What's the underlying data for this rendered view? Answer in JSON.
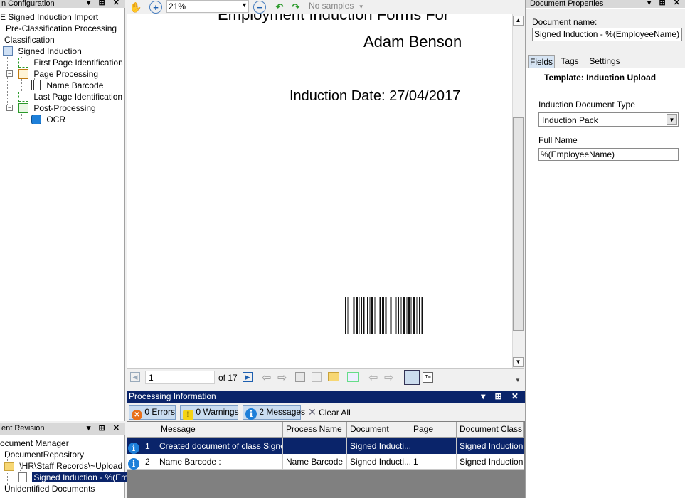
{
  "left_top_panel": {
    "title": "n Configuration",
    "controls": "▾ ⊞ ✕",
    "tree": [
      {
        "label": "E Signed Induction Import"
      },
      {
        "label": "Pre-Classification Processing"
      },
      {
        "label": "Classification"
      },
      {
        "label": "Signed Induction"
      },
      {
        "label": "First Page Identification"
      },
      {
        "label": "Page Processing"
      },
      {
        "label": "Name Barcode"
      },
      {
        "label": "Last Page Identification"
      },
      {
        "label": "Post-Processing"
      },
      {
        "label": "OCR"
      }
    ]
  },
  "left_bottom_panel": {
    "title": "ent Revision",
    "controls": "▾ ⊞ ✕",
    "tree": [
      {
        "label": "ocument Manager"
      },
      {
        "label": "DocumentRepository"
      },
      {
        "label": "\\HR\\Staff Records\\~Upload"
      },
      {
        "label": "Signed Induction - %(Emplo"
      },
      {
        "label": "Unidentified Documents"
      }
    ]
  },
  "viewer": {
    "zoom": "21%",
    "samples_placeholder": "No samples",
    "page_heading_partial": "Employment Induction Forms For",
    "employee_name": "Adam Benson",
    "induction_date_line": "Induction Date: 27/04/2017",
    "page_number": "1",
    "page_total_label": "of 17"
  },
  "processing": {
    "title": "Processing Information",
    "errors_label": "0 Errors",
    "warnings_label": "0 Warnings",
    "messages_label": "2 Messages",
    "clear_label": "Clear All",
    "columns": [
      "Message",
      "Process Name",
      "Document",
      "Page",
      "Document Class"
    ],
    "rows": [
      {
        "index": "1",
        "message": "Created document of class Signe...",
        "process": "",
        "document": "Signed Inducti...",
        "page": "",
        "doc_class": "Signed Induction",
        "selected": true
      },
      {
        "index": "2",
        "message": "Name Barcode :",
        "process": "Name Barcode",
        "document": "Signed Inducti...",
        "page": "1",
        "doc_class": "Signed Induction",
        "selected": false
      }
    ]
  },
  "properties": {
    "title": "Document Properties",
    "doc_name_label": "Document name:",
    "doc_name_value": "Signed Induction - %(EmployeeName)",
    "tabs": [
      "Fields",
      "Tags",
      "Settings"
    ],
    "template_label": "Template: Induction Upload",
    "field1_label": "Induction Document Type",
    "field1_value": "Induction Pack",
    "field2_label": "Full Name",
    "field2_value": "%(EmployeeName)"
  },
  "colors": {
    "selection": "#0a246a",
    "panel_header_active": "#0a246a",
    "info_blue": "#1d7fd9",
    "error_orange": "#e8701a",
    "warning_yellow": "#f5d316"
  }
}
